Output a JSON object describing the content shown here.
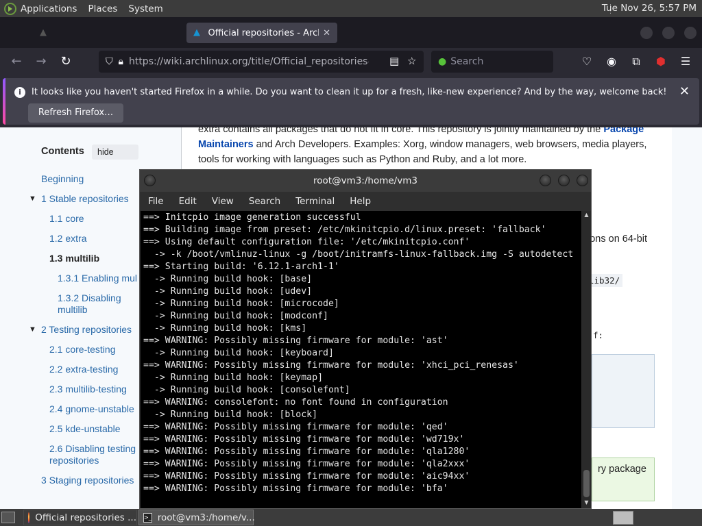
{
  "panel": {
    "applications": "Applications",
    "places": "Places",
    "system": "System",
    "clock": "Tue Nov 26,  5:57 PM"
  },
  "browser": {
    "tabs": [
      {
        "label": "Official repositories - ArchW",
        "active": true
      }
    ],
    "url_host": "https://wiki.archlinux.org",
    "url_path": "/title/Official_repositories#mul",
    "search_placeholder": "Search",
    "notification": {
      "message": "It looks like you haven't started Firefox in a while. Do you want to clean it up for a fresh, like-new experience? And by the way, welcome back!",
      "button": "Refresh Firefox…"
    }
  },
  "article": {
    "para_text_1": "extra contains all packages that do not fit in core. This repository is jointly maintained by the ",
    "para_link_1": "Package Maintainers",
    "para_text_2": " and Arch Developers. Examples: Xorg, window managers, web browsers, media players, tools for working with languages such as Python and Ruby, and a lot more.",
    "frag_1": "ions on 64-bit",
    "frag_2": "lib32/",
    "frag_3": "f:",
    "frag_4": "ry package"
  },
  "toc": {
    "title": "Contents",
    "hide": "hide",
    "items": [
      {
        "label": "Beginning"
      },
      {
        "label": "1  Stable repositories"
      },
      {
        "label": "1.1  core"
      },
      {
        "label": "1.2  extra"
      },
      {
        "label": "1.3  multilib"
      },
      {
        "label": "1.3.1  Enabling mul"
      },
      {
        "label": "1.3.2  Disabling"
      },
      {
        "label": "multilib"
      },
      {
        "label": "2  Testing repositories"
      },
      {
        "label": "2.1  core-testing"
      },
      {
        "label": "2.2  extra-testing"
      },
      {
        "label": "2.3  multilib-testing"
      },
      {
        "label": "2.4  gnome-unstable"
      },
      {
        "label": "2.5  kde-unstable"
      },
      {
        "label": "2.6  Disabling testing"
      },
      {
        "label": "repositories"
      },
      {
        "label": "3  Staging repositories"
      }
    ]
  },
  "terminal": {
    "title": "root@vm3:/home/vm3",
    "menu": [
      "File",
      "Edit",
      "View",
      "Search",
      "Terminal",
      "Help"
    ],
    "lines": [
      "==> Initcpio image generation successful",
      "==> Building image from preset: /etc/mkinitcpio.d/linux.preset: 'fallback'",
      "==> Using default configuration file: '/etc/mkinitcpio.conf'",
      "  -> -k /boot/vmlinuz-linux -g /boot/initramfs-linux-fallback.img -S autodetect",
      "==> Starting build: '6.12.1-arch1-1'",
      "  -> Running build hook: [base]",
      "  -> Running build hook: [udev]",
      "  -> Running build hook: [microcode]",
      "  -> Running build hook: [modconf]",
      "  -> Running build hook: [kms]",
      "==> WARNING: Possibly missing firmware for module: 'ast'",
      "  -> Running build hook: [keyboard]",
      "==> WARNING: Possibly missing firmware for module: 'xhci_pci_renesas'",
      "  -> Running build hook: [keymap]",
      "  -> Running build hook: [consolefont]",
      "==> WARNING: consolefont: no font found in configuration",
      "  -> Running build hook: [block]",
      "==> WARNING: Possibly missing firmware for module: 'qed'",
      "==> WARNING: Possibly missing firmware for module: 'wd719x'",
      "==> WARNING: Possibly missing firmware for module: 'qla1280'",
      "==> WARNING: Possibly missing firmware for module: 'qla2xxx'",
      "==> WARNING: Possibly missing firmware for module: 'aic94xx'",
      "==> WARNING: Possibly missing firmware for module: 'bfa'"
    ]
  },
  "taskbar": {
    "tasks": [
      {
        "label": "Official repositories ..."
      },
      {
        "label": "root@vm3:/home/v..."
      }
    ]
  },
  "colors": {
    "panel": "#3c3c3c",
    "firefox_toolbar": "#2b2a33",
    "wiki_link": "#2a6aa9",
    "terminal_bg": "#000000"
  }
}
